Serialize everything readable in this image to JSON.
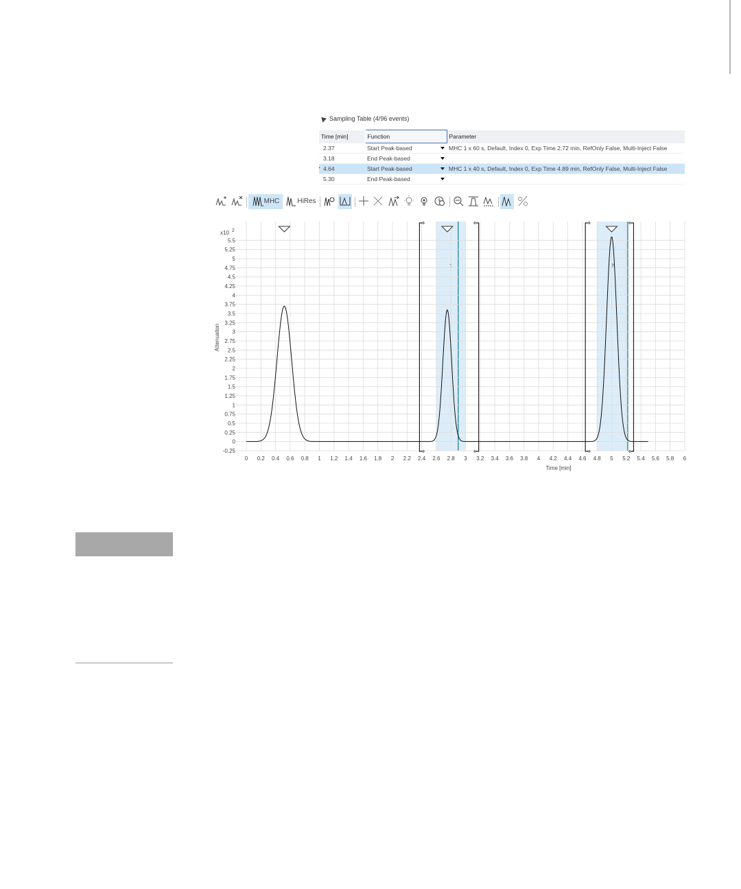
{
  "sampling_table": {
    "title": "Sampling Table (4/96 events)",
    "columns": [
      "Time [min]",
      "Function",
      "Parameter"
    ],
    "rows": [
      {
        "time": "2.37",
        "function": "Start Peak-based",
        "parameter": "MHC 1 x 60 s, Default, Index 0, Exp Time 2.72 min, RefOnly False, Multi-Inject False",
        "active": false
      },
      {
        "time": "3.18",
        "function": "End Peak-based",
        "parameter": "",
        "active": false
      },
      {
        "time": "4.64",
        "function": "Start Peak-based",
        "parameter": "MHC 1 x 40 s, Default, Index 0, Exp Time 4.89 min, RefOnly False, Multi-Inject False",
        "active": true
      },
      {
        "time": "5.30",
        "function": "End Peak-based",
        "parameter": "",
        "active": false
      }
    ]
  },
  "toolbar": {
    "mhc_label": "MHC",
    "hires_label": "HiRes",
    "icons": [
      "add-peak-icon",
      "remove-peak-icon",
      "mhc-mode-icon",
      "hires-mode-icon",
      "peak-select-icon",
      "peak-window-icon",
      "crosshair-icon",
      "delete-icon",
      "reset-icon",
      "light-icon",
      "target-light-icon",
      "stopwatch-icon",
      "zoom-icon",
      "baseline-icon",
      "integration-icon",
      "draw-peak-icon",
      "percent-icon"
    ]
  },
  "chart_data": {
    "type": "line",
    "title": "",
    "xlabel": "Time [min]",
    "ylabel": "Attenuation",
    "y_multiplier_label": "x10",
    "y_exponent": "2",
    "xlim": [
      0,
      6
    ],
    "ylim": [
      -0.25,
      5.75
    ],
    "x_ticks": [
      "0",
      "0.2",
      "0.4",
      "0.6",
      "0.8",
      "1",
      "1.2",
      "1.4",
      "1.6",
      "1.8",
      "2",
      "2.2",
      "2.4",
      "2.6",
      "2.8",
      "3",
      "3.2",
      "3.4",
      "3.6",
      "3.8",
      "4",
      "4.2",
      "4.4",
      "4.6",
      "4.8",
      "5",
      "5.2",
      "5.4",
      "5.6",
      "5.8",
      "6"
    ],
    "y_ticks": [
      "-0.25",
      "0",
      "0.25",
      "0.5",
      "0.75",
      "1",
      "1.25",
      "1.5",
      "1.75",
      "2",
      "2.25",
      "2.5",
      "2.75",
      "3",
      "3.25",
      "3.5",
      "3.75",
      "4",
      "4.25",
      "4.5",
      "4.75",
      "5",
      "5.25",
      "5.5"
    ],
    "grid": true,
    "peaks": [
      {
        "center": 0.52,
        "height": 3.7,
        "sigma": 0.1
      },
      {
        "center": 2.75,
        "height": 3.6,
        "sigma": 0.06
      },
      {
        "center": 5.0,
        "height": 5.6,
        "sigma": 0.07
      }
    ],
    "series": [
      {
        "x": [
          0,
          0.2,
          0.3,
          0.4,
          0.45,
          0.52,
          0.6,
          0.7,
          0.8,
          0.9,
          1.0,
          1.2,
          2.5,
          2.6,
          2.65,
          2.7,
          2.75,
          2.8,
          2.85,
          2.9,
          3.0,
          3.1,
          4.7,
          4.8,
          4.85,
          4.9,
          4.95,
          5.0,
          5.05,
          5.1,
          5.15,
          5.2,
          5.3,
          5.5
        ],
        "y": [
          0.03,
          0.4,
          1.6,
          3.0,
          3.5,
          3.7,
          3.4,
          2.0,
          0.8,
          0.2,
          0.05,
          0.0,
          0.0,
          0.1,
          0.5,
          1.5,
          3.6,
          2.5,
          1.2,
          0.3,
          0.02,
          0.0,
          0.0,
          0.1,
          0.9,
          2.5,
          4.6,
          5.6,
          5.0,
          3.4,
          1.7,
          0.5,
          0.05,
          0.0
        ]
      }
    ],
    "regions": [
      {
        "label": "1",
        "start": 2.6,
        "end": 3.0,
        "marker": 2.9
      },
      {
        "label": "2",
        "start": 4.8,
        "end": 5.22,
        "marker": 5.22
      }
    ],
    "brackets": [
      {
        "at": 2.37,
        "side": "start"
      },
      {
        "at": 3.18,
        "side": "end"
      },
      {
        "at": 4.64,
        "side": "start"
      },
      {
        "at": 5.3,
        "side": "end"
      }
    ],
    "triangle_markers": [
      0.52,
      2.75,
      5.0
    ],
    "accent_color": "#0d7a8a",
    "region_color": "#dcedf9"
  }
}
